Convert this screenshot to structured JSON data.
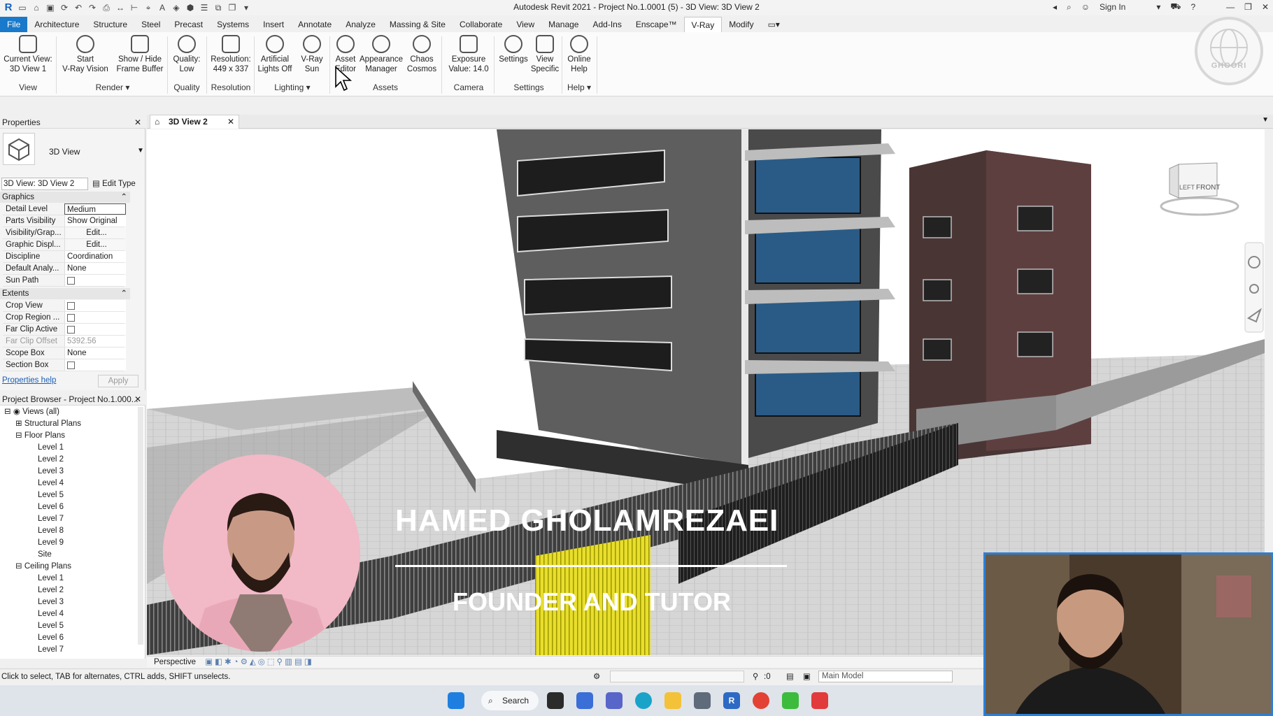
{
  "window": {
    "title": "Autodesk Revit 2021 - Project No.1.0001 (5) - 3D View: 3D View 2",
    "sign_in": "Sign In"
  },
  "tabs": [
    "File",
    "Architecture",
    "Structure",
    "Steel",
    "Precast",
    "Systems",
    "Insert",
    "Annotate",
    "Analyze",
    "Massing & Site",
    "Collaborate",
    "View",
    "Manage",
    "Add-Ins",
    "Enscape™",
    "V-Ray",
    "Modify"
  ],
  "active_tab": "V-Ray",
  "ribbon": {
    "buttons": [
      {
        "l1": "Current View:",
        "l2": "3D View 1"
      },
      {
        "l1": "Start",
        "l2": "V-Ray Vision"
      },
      {
        "l1": "Show / Hide",
        "l2": "Frame Buffer"
      },
      {
        "l1": "Quality:",
        "l2": "Low"
      },
      {
        "l1": "Resolution:",
        "l2": "449 x 337"
      },
      {
        "l1": "Artificial",
        "l2": "Lights Off"
      },
      {
        "l1": "V-Ray",
        "l2": "Sun"
      },
      {
        "l1": "Asset",
        "l2": "Editor"
      },
      {
        "l1": "Appearance",
        "l2": "Manager"
      },
      {
        "l1": "Chaos",
        "l2": "Cosmos"
      },
      {
        "l1": "Exposure",
        "l2": "Value: 14.0"
      },
      {
        "l1": "Settings",
        "l2": ""
      },
      {
        "l1": "View",
        "l2": "Specific"
      },
      {
        "l1": "Online",
        "l2": "Help"
      }
    ],
    "groups": [
      "View",
      "Render",
      "Quality",
      "Resolution",
      "Lighting",
      "Assets",
      "Camera",
      "Settings",
      "Help"
    ],
    "logo_text": "GHOORI"
  },
  "properties": {
    "title": "Properties",
    "type_name": "3D View",
    "view_selector": "3D View: 3D View 2",
    "edit_type": "Edit Type",
    "section_graphics": "Graphics",
    "rows_graphics": [
      {
        "k": "Detail Level",
        "v": "Medium"
      },
      {
        "k": "Parts Visibility",
        "v": "Show Original"
      },
      {
        "k": "Visibility/Grap...",
        "v": "Edit..."
      },
      {
        "k": "Graphic Displ...",
        "v": "Edit..."
      },
      {
        "k": "Discipline",
        "v": "Coordination"
      },
      {
        "k": "Default Analy...",
        "v": "None"
      },
      {
        "k": "Sun Path",
        "v": ""
      }
    ],
    "section_extents": "Extents",
    "rows_extents": [
      {
        "k": "Crop View",
        "v": ""
      },
      {
        "k": "Crop Region ...",
        "v": ""
      },
      {
        "k": "Far Clip Active",
        "v": ""
      },
      {
        "k": "Far Clip Offset",
        "v": "5392.56"
      },
      {
        "k": "Scope Box",
        "v": "None"
      },
      {
        "k": "Section Box",
        "v": ""
      }
    ],
    "help_link": "Properties help",
    "apply": "Apply"
  },
  "browser": {
    "title": "Project Browser - Project No.1.000...",
    "views_all": "Views (all)",
    "structural": "Structural Plans",
    "floor": "Floor Plans",
    "floor_levels": [
      "Level 1",
      "Level 2",
      "Level 3",
      "Level 4",
      "Level 5",
      "Level 6",
      "Level 7",
      "Level 8",
      "Level 9",
      "Site"
    ],
    "ceiling": "Ceiling Plans",
    "ceiling_levels": [
      "Level 1",
      "Level 2",
      "Level 3",
      "Level 4",
      "Level 5",
      "Level 6",
      "Level 7"
    ]
  },
  "viewport": {
    "tab": "3D View 2",
    "mode": "Perspective",
    "viewcube_left": "LEFT",
    "viewcube_front": "FRONT"
  },
  "overlay": {
    "name": "HAMED GHOLAMREZAEI",
    "role": "FOUNDER AND TUTOR"
  },
  "status": {
    "hint": "Click to select, TAB for alternates, CTRL adds, SHIFT unselects.",
    "selection_count": ":0",
    "model": "Main Model"
  },
  "taskbar": {
    "search": "Search"
  }
}
